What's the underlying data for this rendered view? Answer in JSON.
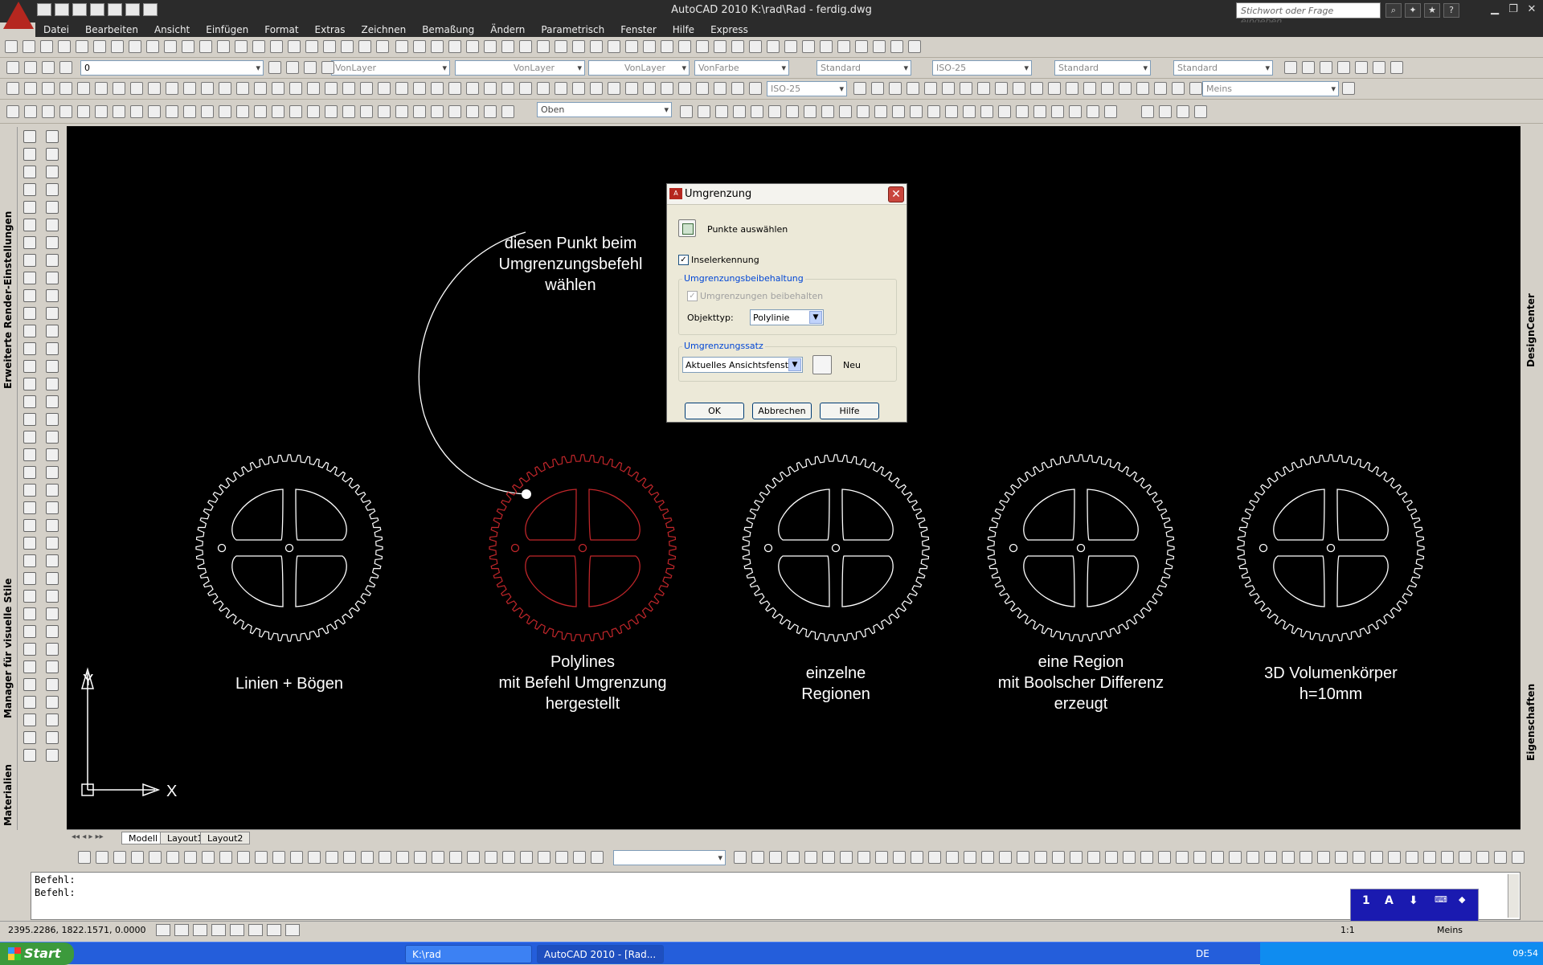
{
  "window": {
    "title": "AutoCAD 2010    K:\\rad\\Rad - ferdig.dwg",
    "search_placeholder": "Stichwort oder Frage eingeben"
  },
  "menu": [
    "Datei",
    "Bearbeiten",
    "Ansicht",
    "Einfügen",
    "Format",
    "Extras",
    "Zeichnen",
    "Bemaßung",
    "Ändern",
    "Parametrisch",
    "Fenster",
    "Hilfe",
    "Express"
  ],
  "toolbars": {
    "layer_value": "0",
    "color": "VonLayer",
    "linetype": "VonLayer",
    "lineweight": "VonLayer",
    "plotstyle": "VonFarbe",
    "text_style": "Standard",
    "dim_style": "ISO-25",
    "table_style": "Standard",
    "mleader_style": "Standard",
    "dim_style2": "ISO-25",
    "workspace": "Meins",
    "view": "Oben"
  },
  "left_palettes": {
    "render_settings": "Erweiterte Render-Einstellungen",
    "visual_styles": "Manager für visuelle Stile",
    "materials": "Materialien"
  },
  "right_palettes": {
    "designcenter": "DesignCenter",
    "properties": "Eigenschaften"
  },
  "drawing": {
    "callout": [
      "diesen Punkt beim",
      "Umgrenzungsbefehl",
      "wählen"
    ],
    "gear_labels": [
      [
        "Linien + Bögen"
      ],
      [
        "Polylines",
        "mit Befehl Umgrenzung",
        "hergestellt"
      ],
      [
        "einzelne",
        "Regionen"
      ],
      [
        "eine Region",
        "mit Boolscher Differenz",
        "erzeugt"
      ],
      [
        "3D Volumenkörper",
        "h=10mm"
      ]
    ],
    "colors": {
      "gear": "#ffffff",
      "highlight": "#c0262a",
      "background": "#000000"
    },
    "ucs": {
      "x": "X",
      "y": "Y"
    }
  },
  "layout_tabs": [
    "Modell",
    "Layout1",
    "Layout2"
  ],
  "dialog": {
    "title": "Umgrenzung",
    "pick_points": "Punkte auswählen",
    "island_detection": "Inselerkennung",
    "island_checked": true,
    "retention_group": "Umgrenzungsbeibehaltung",
    "retain_boundaries": "Umgrenzungen beibehalten",
    "object_type_label": "Objekttyp:",
    "object_type_value": "Polylinie",
    "boundary_set_group": "Umgrenzungssatz",
    "boundary_set_value": "Aktuelles Ansichtsfenster",
    "new_label": "Neu",
    "ok": "OK",
    "cancel": "Abbrechen",
    "help": "Hilfe"
  },
  "command_lines": [
    "Befehl:",
    "Befehl:"
  ],
  "status": {
    "coords": "2395.2286, 1822.1571, 0.0000",
    "scale": "1:1",
    "workspace": "Meins"
  },
  "taskbar": {
    "start": "Start",
    "tasks": [
      "K:\\rad",
      "AutoCAD 2010 - [Rad..."
    ],
    "lang": "DE",
    "clock": "09:54"
  },
  "mini_panel": [
    "1",
    "A"
  ]
}
